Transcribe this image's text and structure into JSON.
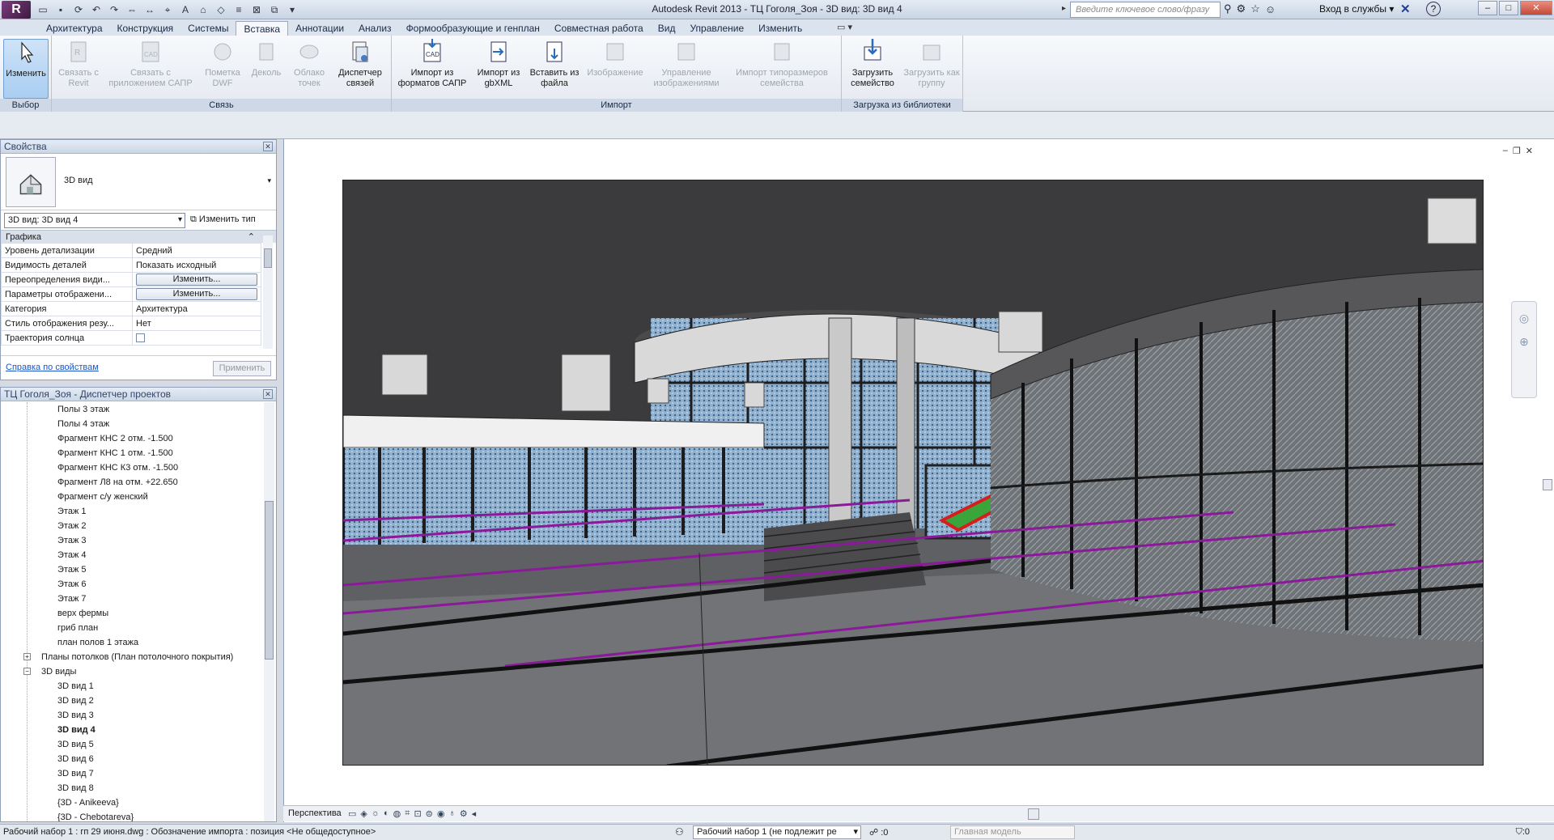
{
  "titlebar": {
    "app_logo": "R",
    "title": "Autodesk Revit 2013 -   ТЦ Гоголя_Зоя - 3D вид: 3D вид 4",
    "search_placeholder": "Введите ключевое слово/фразу",
    "signin": "Вход в службы ▾",
    "help": "?"
  },
  "ribbon_tabs": [
    "Архитектура",
    "Конструкция",
    "Системы",
    "Вставка",
    "Аннотации",
    "Анализ",
    "Формообразующие и генплан",
    "Совместная работа",
    "Вид",
    "Управление",
    "Изменить"
  ],
  "ribbon_tab_extra": "▭ ▾",
  "ribbon": {
    "select": {
      "button": "Изменить",
      "label": "Выбор"
    },
    "link": {
      "label": "Связь",
      "buttons": [
        "Связать с Revit",
        "Связать с приложением САПР",
        "Пометка DWF",
        "Деколь",
        "Облако точек",
        "Диспетчер связей"
      ]
    },
    "import": {
      "label": "Импорт",
      "buttons": [
        "Импорт из форматов САПР",
        "Импорт из gbXML",
        "Вставить из файла",
        "Изображение",
        "Управление изображениями",
        "Импорт типоразмеров семейства"
      ]
    },
    "library": {
      "label": "Загрузка из библиотеки",
      "buttons": [
        "Загрузить семейство",
        "Загрузить как группу"
      ]
    }
  },
  "properties": {
    "title": "Свойства",
    "type_name": "3D вид",
    "instance": "3D вид: 3D вид 4",
    "edit_type": "Изменить тип",
    "group": "Графика",
    "rows": [
      {
        "key": "Уровень детализации",
        "value": "Средний"
      },
      {
        "key": "Видимость деталей",
        "value": "Показать исходный"
      },
      {
        "key": "Переопределения види...",
        "value": "Изменить...",
        "button": true
      },
      {
        "key": "Параметры отображени...",
        "value": "Изменить...",
        "button": true
      },
      {
        "key": "Категория",
        "value": "Архитектура"
      },
      {
        "key": "Стиль отображения резу...",
        "value": "Нет"
      },
      {
        "key": "Траектория солнца",
        "value": "",
        "checkbox": true
      }
    ],
    "help_link": "Справка по свойствам",
    "apply": "Применить"
  },
  "browser": {
    "title": "ТЦ Гоголя_Зоя - Диспетчер проектов",
    "items": [
      {
        "text": "Полы 3 этаж",
        "level": 2
      },
      {
        "text": "Полы 4 этаж",
        "level": 2
      },
      {
        "text": "Фрагмент  КНС 2 отм. -1.500",
        "level": 2
      },
      {
        "text": "Фрагмент КНС 1 отм. -1.500",
        "level": 2
      },
      {
        "text": "Фрагмент КНС К3 отм. -1.500",
        "level": 2
      },
      {
        "text": "Фрагмент Л8 на отм. +22.650",
        "level": 2
      },
      {
        "text": "Фрагмент с/у женский",
        "level": 2
      },
      {
        "text": "Этаж 1",
        "level": 2
      },
      {
        "text": "Этаж 2",
        "level": 2
      },
      {
        "text": "Этаж 3",
        "level": 2
      },
      {
        "text": "Этаж 4",
        "level": 2
      },
      {
        "text": "Этаж 5",
        "level": 2
      },
      {
        "text": "Этаж 6",
        "level": 2
      },
      {
        "text": "Этаж 7",
        "level": 2
      },
      {
        "text": "верх фермы",
        "level": 2
      },
      {
        "text": "гриб план",
        "level": 2
      },
      {
        "text": "план полов 1 этажа",
        "level": 2
      },
      {
        "text": "Планы потолков (План потолочного покрытия)",
        "level": 1,
        "toggle": "+"
      },
      {
        "text": "3D виды",
        "level": 1,
        "toggle": "−"
      },
      {
        "text": "3D вид 1",
        "level": 2
      },
      {
        "text": "3D вид 2",
        "level": 2
      },
      {
        "text": "3D вид 3",
        "level": 2
      },
      {
        "text": "3D вид 4",
        "level": 2,
        "bold": true
      },
      {
        "text": "3D вид 5",
        "level": 2
      },
      {
        "text": "3D вид 6",
        "level": 2
      },
      {
        "text": "3D вид 7",
        "level": 2
      },
      {
        "text": "3D вид 8",
        "level": 2
      },
      {
        "text": "{3D - Anikeeva}",
        "level": 2
      },
      {
        "text": "{3D - Chebotareva}",
        "level": 2
      }
    ]
  },
  "view": {
    "bar_label": "Перспектива"
  },
  "status": {
    "message": "Рабочий набор 1 : гп 29 июня.dwg : Обозначение импорта : позиция <Не общедоступное>",
    "workset": "Рабочий набор 1 (не подлежит ре",
    "count": ":0",
    "model": "Главная модель",
    "filter": ":0"
  },
  "colors": {
    "accent": "#7a3d7c",
    "glass_blue": "#6d8fb0",
    "purple_line": "#8a1a9a",
    "escalator": "#d61e1e"
  }
}
